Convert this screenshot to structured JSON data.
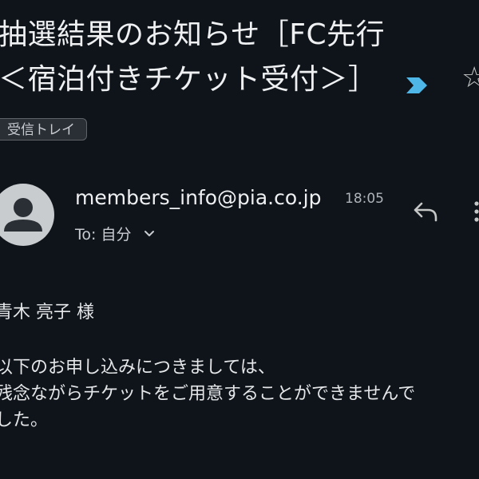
{
  "email": {
    "subject_line1": "抽選結果のお知らせ［FC先行",
    "subject_line2": "＜宿泊付きチケット受付＞］",
    "label": "受信トレイ",
    "sender": "members_info@pia.co.jp",
    "time": "18:05",
    "recipient": "To: 自分",
    "greeting": "青木 亮子 様",
    "body_lines": [
      "以下のお申し込みにつきましては、",
      "残念ながらチケットをご用意することができませんで",
      "した。"
    ]
  },
  "colors": {
    "background": "#0f141b",
    "important_marker": "#4fb7e8",
    "avatar": "#c9cccf"
  },
  "icons": [
    "important-marker-icon",
    "star-icon",
    "person-icon",
    "chevron-down-icon",
    "reply-icon",
    "more-vertical-icon"
  ]
}
